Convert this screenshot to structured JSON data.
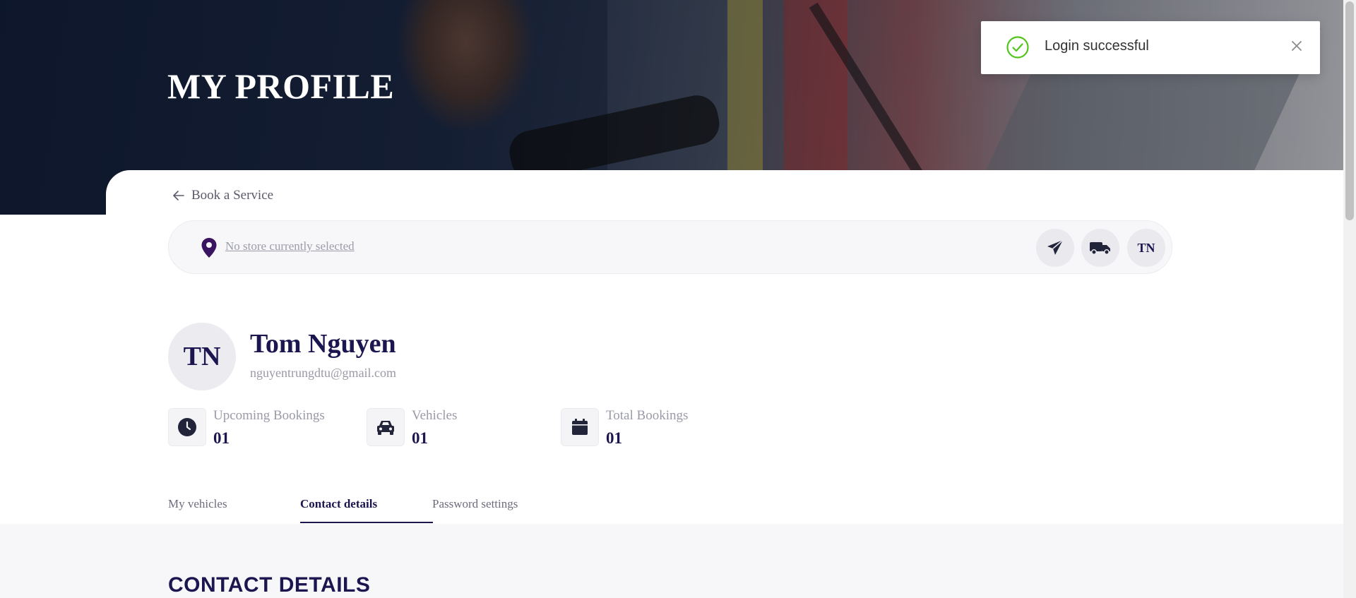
{
  "hero": {
    "title": "MY PROFILE"
  },
  "nav": {
    "back_label": "Book a Service"
  },
  "store_bar": {
    "store_text": "No store currently selected",
    "avatar_initials": "TN"
  },
  "profile": {
    "initials": "TN",
    "name": "Tom Nguyen",
    "email": "nguyentrungdtu@gmail.com"
  },
  "stats": [
    {
      "label": "Upcoming Bookings",
      "value": "01",
      "icon": "clock-icon"
    },
    {
      "label": "Vehicles",
      "value": "01",
      "icon": "car-icon"
    },
    {
      "label": "Total Bookings",
      "value": "01",
      "icon": "calendar-icon"
    }
  ],
  "tabs": [
    {
      "label": "My vehicles",
      "active": false
    },
    {
      "label": "Contact details",
      "active": true
    },
    {
      "label": "Password settings",
      "active": false
    }
  ],
  "section": {
    "title": "CONTACT DETAILS"
  },
  "toast": {
    "message": "Login successful",
    "icon": "check-circle-icon"
  },
  "colors": {
    "primary": "#1b1650",
    "muted": "#9a9aa8",
    "success": "#52c41a",
    "pin": "#3a1460"
  }
}
